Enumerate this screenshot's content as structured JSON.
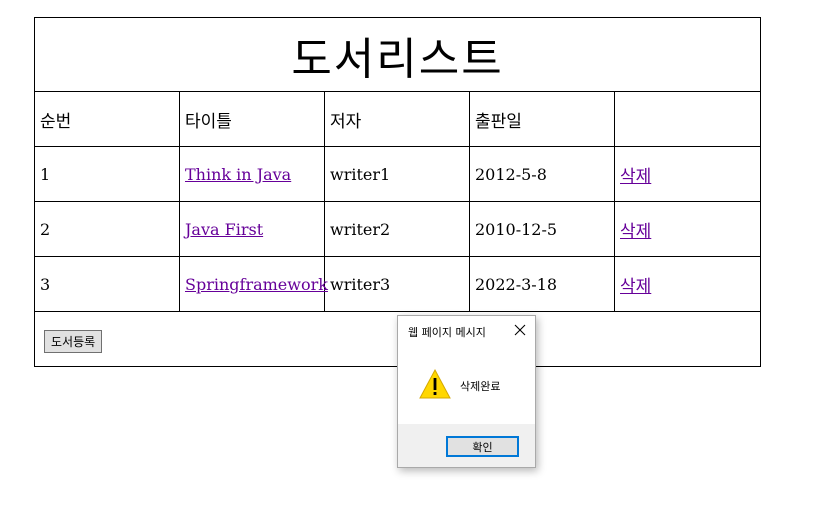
{
  "page": {
    "title": "도서리스트"
  },
  "table": {
    "headers": [
      "순번",
      "타이틀",
      "저자",
      "출판일",
      ""
    ],
    "rows": [
      {
        "no": "1",
        "title": "Think in Java",
        "author": "writer1",
        "date": "2012-5-8",
        "action": "삭제"
      },
      {
        "no": "2",
        "title": "Java First",
        "author": "writer2",
        "date": "2010-12-5",
        "action": "삭제"
      },
      {
        "no": "3",
        "title": "Springframework",
        "author": "writer3",
        "date": "2022-3-18",
        "action": "삭제"
      }
    ],
    "register_button": "도서등록"
  },
  "dialog": {
    "title": "웹 페이지 메시지",
    "message": "삭제완료",
    "ok_button": "확인",
    "icon": "warning-icon",
    "close_icon": "close-icon"
  },
  "colors": {
    "link_visited": "#660099",
    "dialog_footer": "#f0f0f0",
    "ok_border": "#0078d7",
    "warning_fill": "#ffd700"
  }
}
